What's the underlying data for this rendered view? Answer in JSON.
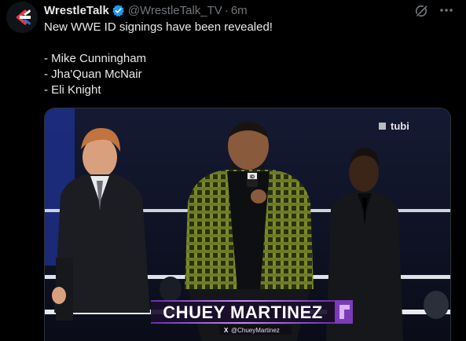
{
  "tweet": {
    "author_name": "WrestleTalk",
    "author_handle": "@WrestleTalk_TV",
    "separator": "·",
    "time": "6m",
    "lines": [
      "New WWE ID signings have been revealed!",
      "",
      "- Mike Cunningham",
      "- Jha'Quan McNair",
      "- Eli Knight"
    ]
  },
  "media": {
    "broadcaster_logo": "tubi",
    "lower_third_name": "CHUEY MARTINEZ",
    "lower_third_handle": "@ChueyMartinez",
    "mic_flag": "ID"
  },
  "colors": {
    "verified": "#1d9bf0",
    "accent_purple": "#a35bd9",
    "shirt_green": "#5a6b2a"
  }
}
